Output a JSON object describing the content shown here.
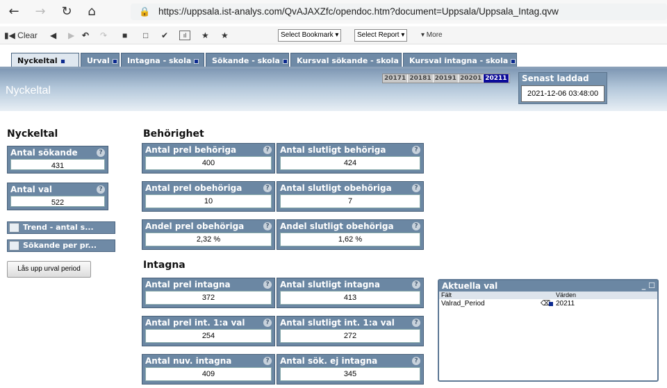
{
  "browser": {
    "url": "https://uppsala.ist-analys.com/QvAJAXZfc/opendoc.htm?document=Uppsala/Uppsala_Intag.qvw"
  },
  "toolbar": {
    "clear": "Clear",
    "bookmark": "Select Bookmark ▾",
    "report": "Select Report ▾",
    "more": "▾ More"
  },
  "tabs": [
    {
      "label": "Nyckeltal"
    },
    {
      "label": "Urval"
    },
    {
      "label": "Intagna - skola"
    },
    {
      "label": "Sökande - skola"
    },
    {
      "label": "Kursval sökande - skola"
    },
    {
      "label": "Kursval intagna - skola"
    }
  ],
  "header": {
    "title": "Nyckeltal",
    "periods": [
      "20171",
      "20181",
      "20191",
      "20201",
      "20211"
    ],
    "selected_period": "20211",
    "last_loaded_label": "Senast laddad",
    "last_loaded_value": "2021-12-06 03:48:00"
  },
  "left": {
    "title": "Nyckeltal",
    "kpis": [
      {
        "label": "Antal sökande",
        "value": "431"
      },
      {
        "label": "Antal val",
        "value": "522"
      }
    ],
    "buttons": [
      {
        "label": "Trend - antal s..."
      },
      {
        "label": "Sökande per pr..."
      }
    ],
    "unlock_label": "Lås upp urval period"
  },
  "behorighet": {
    "title": "Behörighet",
    "kpis": [
      {
        "label": "Antal prel behöriga",
        "value": "400"
      },
      {
        "label": "Antal slutligt behöriga",
        "value": "424"
      },
      {
        "label": "Antal prel obehöriga",
        "value": "10"
      },
      {
        "label": "Antal slutligt obehöriga",
        "value": "7"
      },
      {
        "label": "Andel prel obehöriga",
        "value": "2,32 %"
      },
      {
        "label": "Andel slutligt obehöriga",
        "value": "1,62 %"
      }
    ]
  },
  "intagna": {
    "title": "Intagna",
    "kpis": [
      {
        "label": "Antal prel intagna",
        "value": "372"
      },
      {
        "label": "Antal slutligt intagna",
        "value": "413"
      },
      {
        "label": "Antal prel int. 1:a val",
        "value": "254"
      },
      {
        "label": "Antal slutligt int. 1:a val",
        "value": "272"
      },
      {
        "label": "Antal nuv. intagna",
        "value": "409"
      },
      {
        "label": "Antal sök. ej intagna",
        "value": "345"
      }
    ]
  },
  "current_selections": {
    "title": "Aktuella val",
    "col_field": "Fält",
    "col_values": "Värden",
    "rows": [
      {
        "field": "Valrad_Period",
        "value": "20211"
      }
    ]
  },
  "help_glyph": "?"
}
